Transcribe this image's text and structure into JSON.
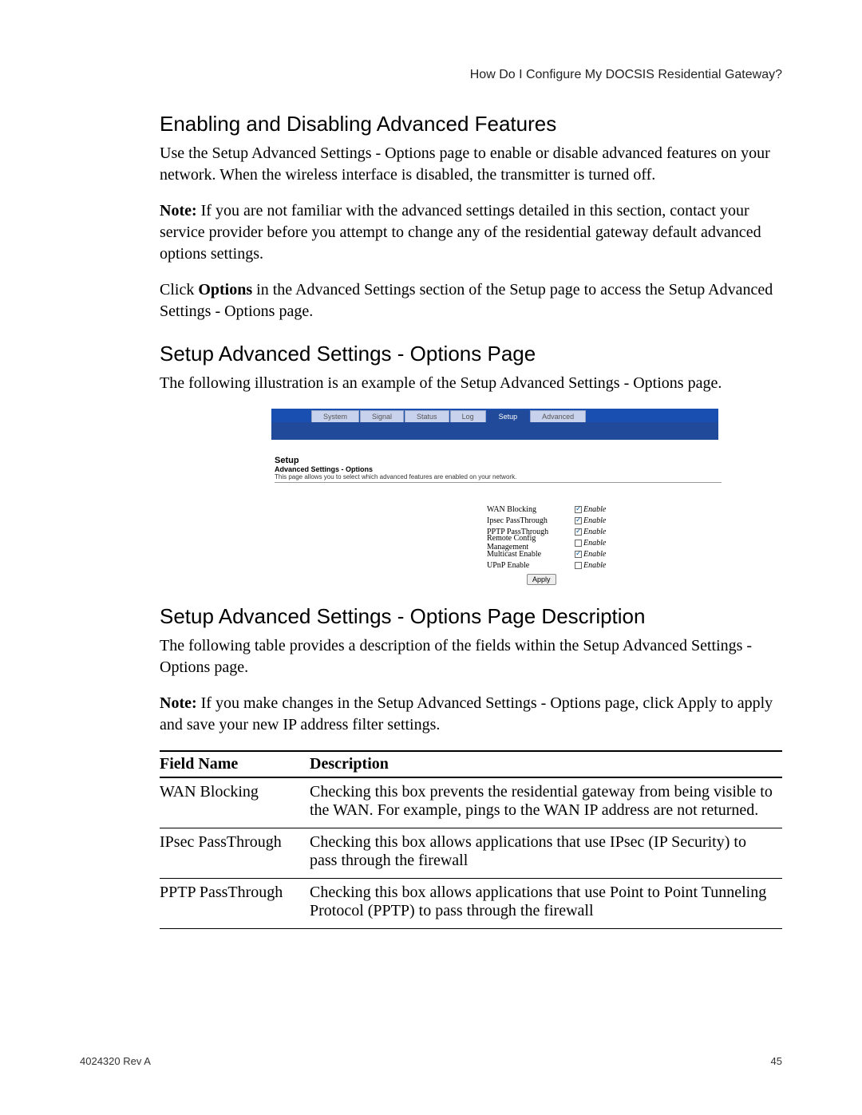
{
  "header": {
    "running_head": "How Do I Configure My DOCSIS Residential Gateway?"
  },
  "sections": {
    "h1": "Enabling and Disabling Advanced Features",
    "p1": "Use the Setup Advanced Settings - Options page to enable or disable advanced features on your network. When the wireless interface is disabled, the transmitter is turned off.",
    "note1_label": "Note:",
    "note1_body": " If you are not familiar with the advanced settings detailed in this section, contact your service provider before you attempt to change any of the residential gateway default advanced options settings.",
    "p2_a": "Click ",
    "p2_bold": "Options",
    "p2_b": " in the Advanced Settings section of the Setup page to access the Setup Advanced Settings - Options page.",
    "h2": "Setup Advanced Settings - Options Page",
    "p3": "The following illustration is an example of the Setup Advanced Settings - Options page.",
    "h3": "Setup Advanced Settings - Options Page Description",
    "p4": "The following table provides a description of the fields within the Setup Advanced Settings - Options page.",
    "note2_label": "Note:",
    "note2_body": " If you make changes in the Setup Advanced Settings - Options page, click Apply to apply and save your new IP address filter settings."
  },
  "illustration": {
    "tabs": [
      "System",
      "Signal",
      "Status",
      "Log",
      "Setup",
      "Advanced"
    ],
    "active_tab": "Setup",
    "block_title": "Setup",
    "block_sub": "Advanced Settings - Options",
    "block_desc": "This page allows you to select which advanced features are enabled on your network.",
    "options": [
      {
        "label": "WAN Blocking",
        "checked": true
      },
      {
        "label": "Ipsec PassThrough",
        "checked": true
      },
      {
        "label": "PPTP PassThrough",
        "checked": true
      },
      {
        "label": "Remote Config Management",
        "checked": false
      },
      {
        "label": "Multicast Enable",
        "checked": true
      },
      {
        "label": "UPnP Enable",
        "checked": false
      }
    ],
    "enable_text": "Enable",
    "apply_label": "Apply"
  },
  "table": {
    "col1": "Field Name",
    "col2": "Description",
    "rows": [
      {
        "name": "WAN Blocking",
        "desc": "Checking this box prevents the residential gateway from being visible to the WAN. For example, pings to the WAN IP address are not returned."
      },
      {
        "name": "IPsec PassThrough",
        "desc": "Checking this box allows applications that use IPsec (IP Security) to pass through the firewall"
      },
      {
        "name": "PPTP PassThrough",
        "desc": "Checking this box allows applications that use Point to Point Tunneling Protocol (PPTP) to pass through the firewall"
      }
    ]
  },
  "footer": {
    "left": "4024320 Rev A",
    "right": "45"
  }
}
